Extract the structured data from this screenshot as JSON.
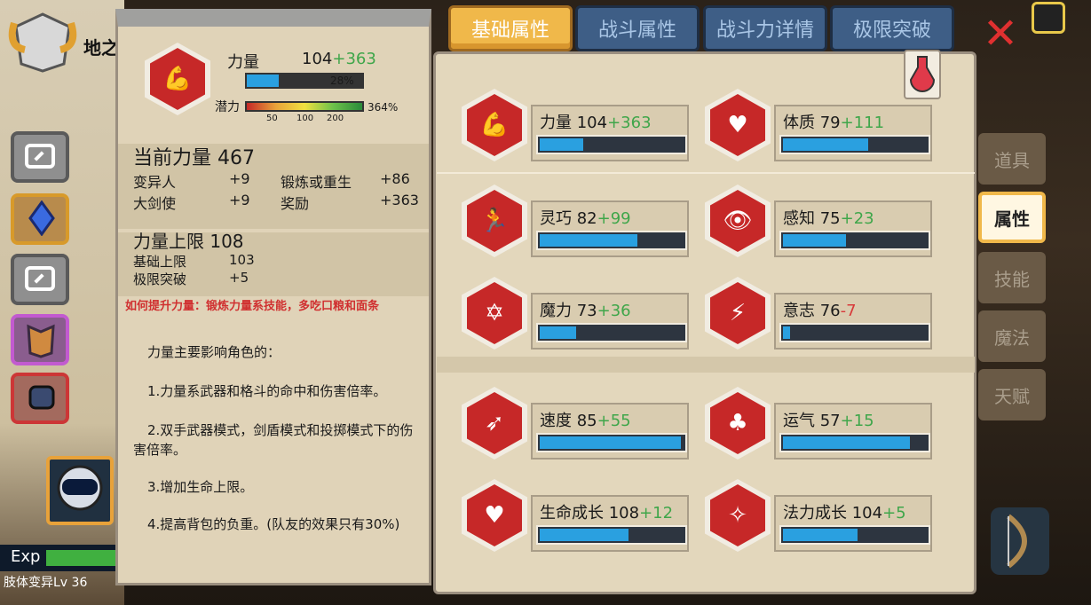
{
  "character": {
    "name": "地之",
    "level_text": "肢体变异Lv 36",
    "exp_label": "Exp"
  },
  "detail": {
    "stat_name": "力量",
    "base": "104",
    "bonus": "+363",
    "progress_text": "28%",
    "progress_value": 0.28,
    "potential_label": "潜力",
    "potential_ticks": [
      "50",
      "100",
      "200"
    ],
    "potential_value": "364%",
    "current_label": "当前力量 467",
    "sources": [
      {
        "name": "变异人",
        "value": "+9"
      },
      {
        "name": "锻炼或重生",
        "value": "+86"
      },
      {
        "name": "大剑使",
        "value": "+9"
      },
      {
        "name": "奖励",
        "value": "+363"
      }
    ],
    "cap_label": "力量上限 108",
    "cap_items": [
      {
        "name": "基础上限",
        "value": "103"
      },
      {
        "name": "极限突破",
        "value": "+5"
      }
    ],
    "tip": "如何提升力量：锻炼力量系技能，多吃口粮和面条",
    "desc_title": "力量主要影响角色的：",
    "desc": [
      "1.力量系武器和格斗的命中和伤害倍率。",
      "2.双手武器模式，剑盾模式和投掷模式下的伤害倍率。",
      "3.增加生命上限。",
      "4.提高背包的负重。(队友的效果只有30%)"
    ]
  },
  "tabs": [
    "基础属性",
    "战斗属性",
    "战斗力详情",
    "极限突破"
  ],
  "side_tabs": [
    "道具",
    "属性",
    "技能",
    "魔法",
    "天赋"
  ],
  "stats": [
    {
      "name": "力量",
      "base": "104",
      "bonus": "+363",
      "sign": "plus",
      "fill": 0.3,
      "icon": "arm-icon",
      "glyph": "💪"
    },
    {
      "name": "体质",
      "base": "79",
      "bonus": "+111",
      "sign": "plus",
      "fill": 0.59,
      "icon": "body-icon",
      "glyph": "♥"
    },
    {
      "name": "灵巧",
      "base": "82",
      "bonus": "+99",
      "sign": "plus",
      "fill": 0.68,
      "icon": "runner-icon",
      "glyph": "🏃"
    },
    {
      "name": "感知",
      "base": "75",
      "bonus": "+23",
      "sign": "plus",
      "fill": 0.44,
      "icon": "eye-icon",
      "glyph": "👁"
    },
    {
      "name": "魔力",
      "base": "73",
      "bonus": "+36",
      "sign": "plus",
      "fill": 0.25,
      "icon": "hexagram-icon",
      "glyph": "✡"
    },
    {
      "name": "意志",
      "base": "76",
      "bonus": "-7",
      "sign": "minus",
      "fill": 0.05,
      "icon": "head-icon",
      "glyph": "⚡"
    },
    {
      "name": "速度",
      "base": "85",
      "bonus": "+55",
      "sign": "plus",
      "fill": 0.98,
      "icon": "wing-icon",
      "glyph": "➶"
    },
    {
      "name": "运气",
      "base": "57",
      "bonus": "+15",
      "sign": "plus",
      "fill": 0.88,
      "icon": "clover-icon",
      "glyph": "♣"
    },
    {
      "name": "生命成长",
      "base": "108",
      "bonus": "+12",
      "sign": "plus",
      "fill": 0.62,
      "icon": "heart-icon",
      "glyph": "♥"
    },
    {
      "name": "法力成长",
      "base": "104",
      "bonus": "+5",
      "sign": "plus",
      "fill": 0.52,
      "icon": "rune-icon",
      "glyph": "✧"
    }
  ]
}
